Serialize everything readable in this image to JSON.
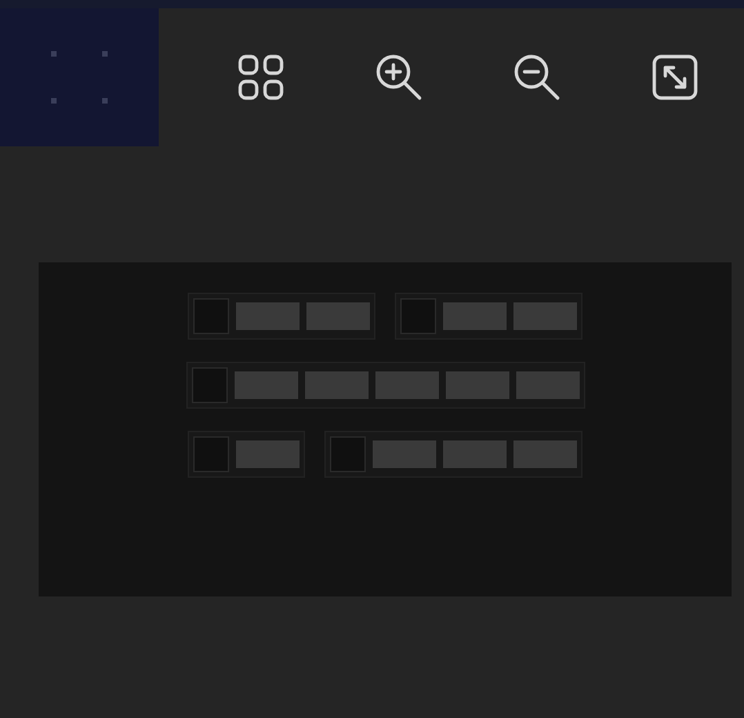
{
  "toolbar": [
    {
      "kind": "grid"
    },
    {
      "kind": "zoom_in"
    },
    {
      "kind": "zoom_out"
    },
    {
      "kind": "fit"
    }
  ],
  "canvas": {
    "rows": [
      {
        "groups": [
          {
            "items": [
              {
                "kind": "header"
              },
              {
                "kind": "block"
              },
              {
                "kind": "block"
              }
            ]
          },
          {
            "items": [
              {
                "kind": "header"
              },
              {
                "kind": "block"
              },
              {
                "kind": "block"
              }
            ]
          }
        ]
      },
      {
        "groups": [
          {
            "items": [
              {
                "kind": "header"
              },
              {
                "kind": "block"
              },
              {
                "kind": "block"
              },
              {
                "kind": "block"
              },
              {
                "kind": "block"
              },
              {
                "kind": "block"
              }
            ]
          }
        ]
      },
      {
        "groups": [
          {
            "items": [
              {
                "kind": "header"
              },
              {
                "kind": "block"
              }
            ]
          },
          {
            "items": [
              {
                "kind": "header"
              },
              {
                "kind": "block"
              },
              {
                "kind": "block"
              },
              {
                "kind": "block"
              }
            ]
          }
        ]
      }
    ]
  }
}
